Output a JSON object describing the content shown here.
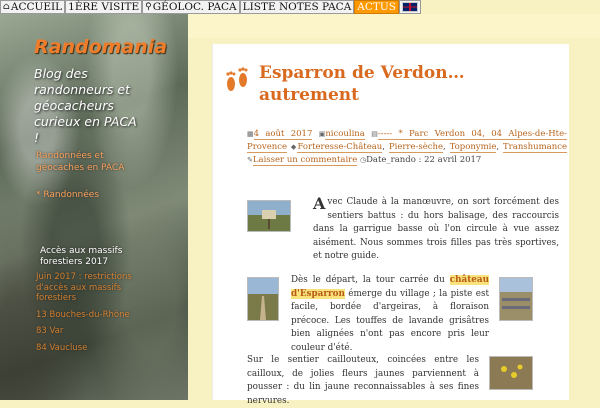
{
  "nav": {
    "items": [
      {
        "label": "ACCUEIL",
        "icon": "home-icon"
      },
      {
        "label": "1ÈRE VISITE"
      },
      {
        "label": "GÉOLOC. PACA",
        "icon": "map-pin-icon"
      },
      {
        "label": "LISTE NOTES PACA"
      },
      {
        "label": "ACTUS",
        "active": true
      }
    ],
    "flag_icon": "uk-flag-icon"
  },
  "sidebar": {
    "site_title": "Randomania",
    "description": "Blog des randonneurs et géocacheurs curieux en PACA !",
    "link1": "Randonnées et géocaches en PACA",
    "link2": "* Randonnées",
    "widget_title": "Accès aux massifs forestiers 2017",
    "widget_items": [
      "Juin 2017 : restrictions d'accès aux massifs forestiers",
      "13 Bouches-du-Rhône",
      "83 Var",
      "84 Vaucluse"
    ]
  },
  "post": {
    "title": "Esparron de Verdon… autrement",
    "date": "4 août 2017",
    "author": "nicoulina",
    "category": "----- * Parc Verdon 04, 04 Alpes-de-Hte-Provence",
    "tags": [
      "Forteresse-Château",
      "Pierre-sèche",
      "Toponymie",
      "Transhumance"
    ],
    "comment_link": "Laisser un commentaire",
    "date_rando": "Date_rando : 22 avril 2017",
    "p1_cap": "A",
    "p1": "vec Claude à la manœuvre, on sort forcément des sentiers battus : du hors balisage, des raccourcis dans la garrigue basse où l'on circule à vue assez aisément. Nous sommes trois filles pas très sportives, et notre guide.",
    "p2_a": "Dès le départ, la tour carrée du ",
    "p2_hl": "château d'Esparron",
    "p2_b": " émerge du village ; la piste est facile, bordée d'argeiras, à floraison précoce. Les touffes de lavande grisâtres bien alignées n'ont pas encore pris leur couleur d'été.",
    "p3": "Sur le sentier caillouteux, coincées entre les cailloux, de jolies fleurs jaunes parviennent à pousser : du lin jaune reconnaissables à ses fines nervures."
  },
  "colors": {
    "accent": "#d8691f",
    "nav_active": "#ff9900",
    "background": "#f8f2c2"
  }
}
